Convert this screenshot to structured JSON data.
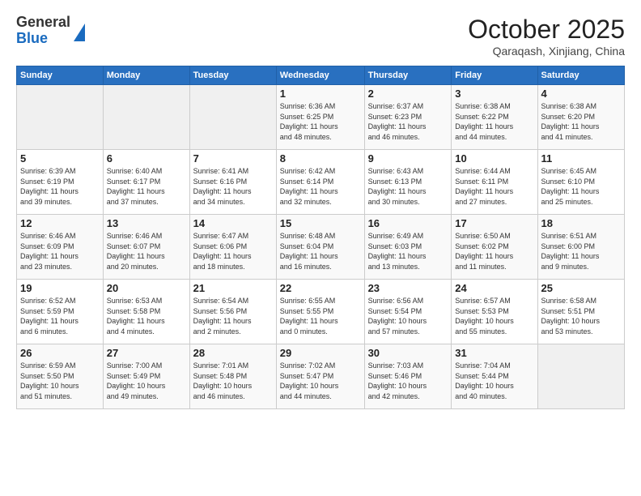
{
  "logo": {
    "general": "General",
    "blue": "Blue"
  },
  "title": "October 2025",
  "location": "Qaraqash, Xinjiang, China",
  "weekdays": [
    "Sunday",
    "Monday",
    "Tuesday",
    "Wednesday",
    "Thursday",
    "Friday",
    "Saturday"
  ],
  "weeks": [
    [
      {
        "day": "",
        "info": ""
      },
      {
        "day": "",
        "info": ""
      },
      {
        "day": "",
        "info": ""
      },
      {
        "day": "1",
        "info": "Sunrise: 6:36 AM\nSunset: 6:25 PM\nDaylight: 11 hours\nand 48 minutes."
      },
      {
        "day": "2",
        "info": "Sunrise: 6:37 AM\nSunset: 6:23 PM\nDaylight: 11 hours\nand 46 minutes."
      },
      {
        "day": "3",
        "info": "Sunrise: 6:38 AM\nSunset: 6:22 PM\nDaylight: 11 hours\nand 44 minutes."
      },
      {
        "day": "4",
        "info": "Sunrise: 6:38 AM\nSunset: 6:20 PM\nDaylight: 11 hours\nand 41 minutes."
      }
    ],
    [
      {
        "day": "5",
        "info": "Sunrise: 6:39 AM\nSunset: 6:19 PM\nDaylight: 11 hours\nand 39 minutes."
      },
      {
        "day": "6",
        "info": "Sunrise: 6:40 AM\nSunset: 6:17 PM\nDaylight: 11 hours\nand 37 minutes."
      },
      {
        "day": "7",
        "info": "Sunrise: 6:41 AM\nSunset: 6:16 PM\nDaylight: 11 hours\nand 34 minutes."
      },
      {
        "day": "8",
        "info": "Sunrise: 6:42 AM\nSunset: 6:14 PM\nDaylight: 11 hours\nand 32 minutes."
      },
      {
        "day": "9",
        "info": "Sunrise: 6:43 AM\nSunset: 6:13 PM\nDaylight: 11 hours\nand 30 minutes."
      },
      {
        "day": "10",
        "info": "Sunrise: 6:44 AM\nSunset: 6:11 PM\nDaylight: 11 hours\nand 27 minutes."
      },
      {
        "day": "11",
        "info": "Sunrise: 6:45 AM\nSunset: 6:10 PM\nDaylight: 11 hours\nand 25 minutes."
      }
    ],
    [
      {
        "day": "12",
        "info": "Sunrise: 6:46 AM\nSunset: 6:09 PM\nDaylight: 11 hours\nand 23 minutes."
      },
      {
        "day": "13",
        "info": "Sunrise: 6:46 AM\nSunset: 6:07 PM\nDaylight: 11 hours\nand 20 minutes."
      },
      {
        "day": "14",
        "info": "Sunrise: 6:47 AM\nSunset: 6:06 PM\nDaylight: 11 hours\nand 18 minutes."
      },
      {
        "day": "15",
        "info": "Sunrise: 6:48 AM\nSunset: 6:04 PM\nDaylight: 11 hours\nand 16 minutes."
      },
      {
        "day": "16",
        "info": "Sunrise: 6:49 AM\nSunset: 6:03 PM\nDaylight: 11 hours\nand 13 minutes."
      },
      {
        "day": "17",
        "info": "Sunrise: 6:50 AM\nSunset: 6:02 PM\nDaylight: 11 hours\nand 11 minutes."
      },
      {
        "day": "18",
        "info": "Sunrise: 6:51 AM\nSunset: 6:00 PM\nDaylight: 11 hours\nand 9 minutes."
      }
    ],
    [
      {
        "day": "19",
        "info": "Sunrise: 6:52 AM\nSunset: 5:59 PM\nDaylight: 11 hours\nand 6 minutes."
      },
      {
        "day": "20",
        "info": "Sunrise: 6:53 AM\nSunset: 5:58 PM\nDaylight: 11 hours\nand 4 minutes."
      },
      {
        "day": "21",
        "info": "Sunrise: 6:54 AM\nSunset: 5:56 PM\nDaylight: 11 hours\nand 2 minutes."
      },
      {
        "day": "22",
        "info": "Sunrise: 6:55 AM\nSunset: 5:55 PM\nDaylight: 11 hours\nand 0 minutes."
      },
      {
        "day": "23",
        "info": "Sunrise: 6:56 AM\nSunset: 5:54 PM\nDaylight: 10 hours\nand 57 minutes."
      },
      {
        "day": "24",
        "info": "Sunrise: 6:57 AM\nSunset: 5:53 PM\nDaylight: 10 hours\nand 55 minutes."
      },
      {
        "day": "25",
        "info": "Sunrise: 6:58 AM\nSunset: 5:51 PM\nDaylight: 10 hours\nand 53 minutes."
      }
    ],
    [
      {
        "day": "26",
        "info": "Sunrise: 6:59 AM\nSunset: 5:50 PM\nDaylight: 10 hours\nand 51 minutes."
      },
      {
        "day": "27",
        "info": "Sunrise: 7:00 AM\nSunset: 5:49 PM\nDaylight: 10 hours\nand 49 minutes."
      },
      {
        "day": "28",
        "info": "Sunrise: 7:01 AM\nSunset: 5:48 PM\nDaylight: 10 hours\nand 46 minutes."
      },
      {
        "day": "29",
        "info": "Sunrise: 7:02 AM\nSunset: 5:47 PM\nDaylight: 10 hours\nand 44 minutes."
      },
      {
        "day": "30",
        "info": "Sunrise: 7:03 AM\nSunset: 5:46 PM\nDaylight: 10 hours\nand 42 minutes."
      },
      {
        "day": "31",
        "info": "Sunrise: 7:04 AM\nSunset: 5:44 PM\nDaylight: 10 hours\nand 40 minutes."
      },
      {
        "day": "",
        "info": ""
      }
    ]
  ]
}
